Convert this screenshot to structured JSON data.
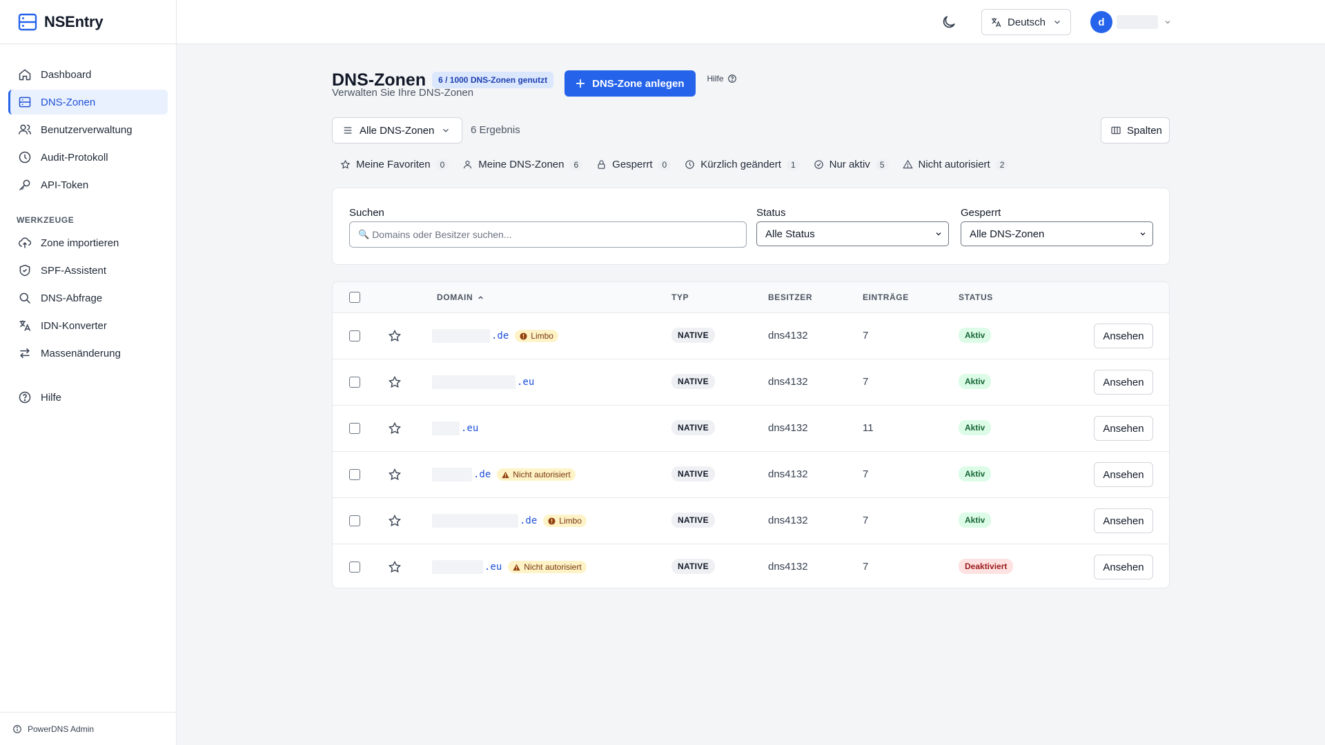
{
  "app": {
    "name": "NSEntry",
    "footer": "PowerDNS Admin"
  },
  "sidebar": {
    "items": [
      {
        "label": "Dashboard",
        "icon": "home-icon"
      },
      {
        "label": "DNS-Zonen",
        "icon": "server-icon",
        "active": true
      },
      {
        "label": "Benutzerverwaltung",
        "icon": "users-icon"
      },
      {
        "label": "Audit-Protokoll",
        "icon": "clock-icon"
      },
      {
        "label": "API-Token",
        "icon": "key-icon"
      }
    ],
    "tools_heading": "WERKZEUGE",
    "tools": [
      {
        "label": "Zone importieren",
        "icon": "upload-cloud-icon"
      },
      {
        "label": "SPF-Assistent",
        "icon": "shield-icon"
      },
      {
        "label": "DNS-Abfrage",
        "icon": "search-icon"
      },
      {
        "label": "IDN-Konverter",
        "icon": "translate-icon"
      },
      {
        "label": "Massenänderung",
        "icon": "arrows-icon"
      }
    ],
    "help": {
      "label": "Hilfe",
      "icon": "help-circle-icon"
    }
  },
  "topbar": {
    "language": "Deutsch",
    "avatar_letter": "d"
  },
  "page": {
    "title": "DNS-Zonen",
    "usage_badge": "6 / 1000 DNS-Zonen genutzt",
    "create_button": "DNS-Zone anlegen",
    "help_link": "Hilfe",
    "subtitle": "Verwalten Sie Ihre DNS-Zonen",
    "view_select": "Alle DNS-Zonen",
    "result_count": "6 Ergebnis",
    "columns_button": "Spalten"
  },
  "chips": [
    {
      "label": "Meine Favoriten",
      "count": "0",
      "icon": "star-icon"
    },
    {
      "label": "Meine DNS-Zonen",
      "count": "6",
      "icon": "user-icon"
    },
    {
      "label": "Gesperrt",
      "count": "0",
      "icon": "lock-icon"
    },
    {
      "label": "Kürzlich geändert",
      "count": "1",
      "icon": "clock-icon"
    },
    {
      "label": "Nur aktiv",
      "count": "5",
      "icon": "check-circle-icon"
    },
    {
      "label": "Nicht autorisiert",
      "count": "2",
      "icon": "warning-icon"
    }
  ],
  "filters": {
    "search_label": "Suchen",
    "search_placeholder": "Domains oder Besitzer suchen...",
    "status_label": "Status",
    "status_value": "Alle Status",
    "locked_label": "Gesperrt",
    "locked_value": "Alle DNS-Zonen"
  },
  "table": {
    "columns": {
      "domain": "DOMAIN",
      "type": "TYP",
      "owner": "BESITZER",
      "entries": "EINTRÄGE",
      "status": "STATUS"
    },
    "action_label": "Ansehen",
    "rows": [
      {
        "tld": ".de",
        "tag": "Limbo",
        "tag_kind": "limbo",
        "type": "NATIVE",
        "owner": "dns4132",
        "entries": "7",
        "status": "Aktiv",
        "active": true
      },
      {
        "tld": ".eu",
        "tag": "",
        "tag_kind": "",
        "type": "NATIVE",
        "owner": "dns4132",
        "entries": "7",
        "status": "Aktiv",
        "active": true
      },
      {
        "tld": ".eu",
        "tag": "",
        "tag_kind": "",
        "type": "NATIVE",
        "owner": "dns4132",
        "entries": "11",
        "status": "Aktiv",
        "active": true
      },
      {
        "tld": ".de",
        "tag": "Nicht autorisiert",
        "tag_kind": "unauth",
        "type": "NATIVE",
        "owner": "dns4132",
        "entries": "7",
        "status": "Aktiv",
        "active": true
      },
      {
        "tld": ".de",
        "tag": "Limbo",
        "tag_kind": "limbo",
        "type": "NATIVE",
        "owner": "dns4132",
        "entries": "7",
        "status": "Aktiv",
        "active": true
      },
      {
        "tld": ".eu",
        "tag": "Nicht autorisiert",
        "tag_kind": "unauth",
        "type": "NATIVE",
        "owner": "dns4132",
        "entries": "7",
        "status": "Deaktiviert",
        "active": false
      }
    ]
  },
  "colors": {
    "accent": "#2563eb",
    "active_status": "#166534",
    "inactive_status": "#991b1b",
    "warning": "#fef3c7"
  }
}
